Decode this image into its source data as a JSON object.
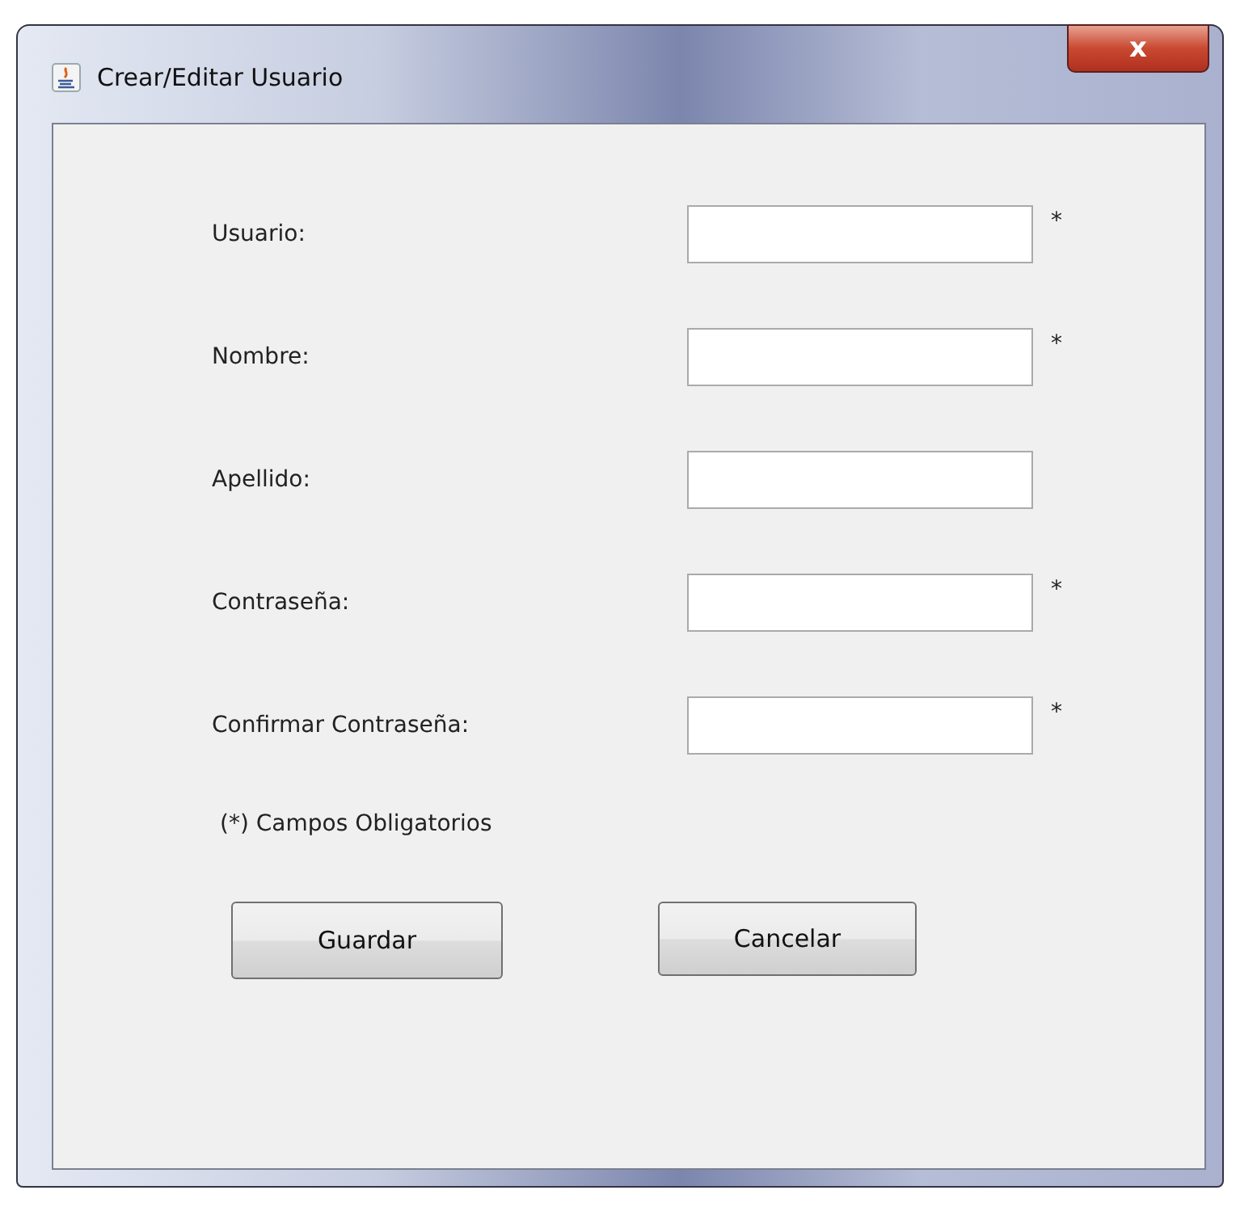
{
  "window": {
    "title": "Crear/Editar Usuario",
    "close": "x"
  },
  "fields": [
    {
      "label": "Usuario:",
      "required_mark": "*"
    },
    {
      "label": "Nombre:",
      "required_mark": "*"
    },
    {
      "label": "Apellido:"
    },
    {
      "label": "Contraseña:",
      "required_mark": "*"
    },
    {
      "label": "Confirmar Contraseña:",
      "required_mark": "*"
    }
  ],
  "note": "(*) Campos Obligatorios",
  "buttons": [
    "Guardar",
    "Cancelar"
  ]
}
